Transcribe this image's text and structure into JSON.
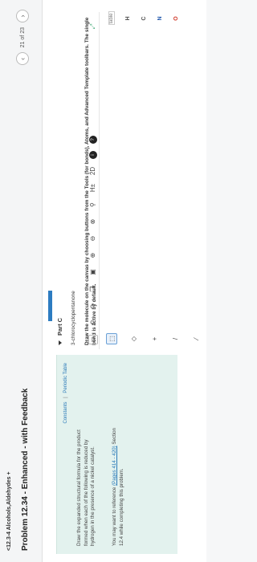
{
  "header": {
    "breadcrumb": "<12.3-4 Alcohols,Aldehydes +",
    "title": "Problem 12.34 - Enhanced - with Feedback",
    "page_counter": "21 of 23",
    "prev_icon": "chevron-left-icon",
    "next_icon": "chevron-right-icon"
  },
  "resources": {
    "constants_link": "Constants",
    "separator": "|",
    "periodic_table_link": "Periodic Table"
  },
  "instructions": "Draw the expanded structural formula for the product formed when each of the following is reduced by hydrogen in the presence of a nickel catalyst.",
  "reference": {
    "prefix": "You may want to reference",
    "link": "(Pages 414 - 420)",
    "suffix": "Section 12.4 while completing this problem."
  },
  "part": {
    "label": "Part C",
    "compound": "3-chlorocyclopentanone",
    "directions": "Draw the molecule on the canvas by choosing buttons from the Tools (for bonds), Atoms, and Advanced Template toolbars. The single bond is active by default."
  },
  "toolbar": {
    "tools": [
      {
        "name": "new-document-icon",
        "glyph": "▭"
      },
      {
        "name": "undo-icon",
        "glyph": "↶"
      },
      {
        "name": "redo-icon",
        "glyph": "↷"
      },
      {
        "name": "copy-icon",
        "glyph": "❐"
      },
      {
        "name": "paste-icon",
        "glyph": "▣"
      },
      {
        "name": "zoom-in-icon",
        "glyph": "⊕"
      },
      {
        "name": "zoom-out-icon",
        "glyph": "⊖"
      },
      {
        "name": "zoom-fit-icon",
        "glyph": "⊗"
      },
      {
        "name": "search-icon",
        "glyph": "⚲"
      },
      {
        "name": "explicit-hydrogens-icon",
        "glyph": "H±"
      },
      {
        "name": "2d-clean-icon",
        "glyph": "2D"
      },
      {
        "name": "info-icon",
        "glyph": "i"
      },
      {
        "name": "help-icon",
        "glyph": "?"
      },
      {
        "name": "expand-icon",
        "glyph": "⤢"
      }
    ]
  },
  "side_tools": [
    {
      "name": "selection-tool-icon",
      "glyph": "⬚"
    },
    {
      "name": "eraser-icon",
      "glyph": "◇"
    },
    {
      "name": "charge-plus-icon",
      "glyph": "+"
    },
    {
      "name": "single-bond-icon",
      "glyph": "/"
    },
    {
      "name": "chain-bond-icon",
      "glyph": "⁄"
    },
    {
      "name": "wedge-bond-icon",
      "glyph": "╱"
    }
  ],
  "atoms": {
    "periodic_table_button": "table",
    "items": [
      "H",
      "C",
      "N",
      "O"
    ]
  },
  "colors": {
    "info_box_bg": "#e3f2ee",
    "link": "#2a7ab8",
    "progress": "#2d7cc1",
    "nitrogen": "#2a5fb0",
    "oxygen": "#d03b2c"
  }
}
